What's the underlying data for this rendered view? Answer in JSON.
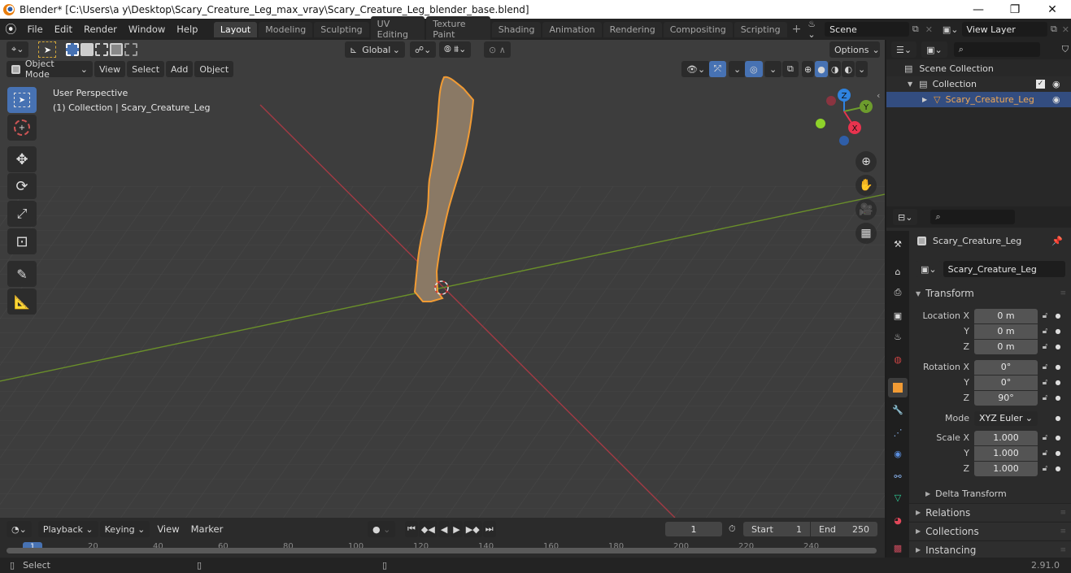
{
  "window": {
    "title": "Blender* [C:\\Users\\a y\\Desktop\\Scary_Creature_Leg_max_vray\\Scary_Creature_Leg_blender_base.blend]",
    "controls": {
      "minimize": "—",
      "maximize": "❐",
      "close": "✕"
    }
  },
  "menu": [
    "File",
    "Edit",
    "Render",
    "Window",
    "Help"
  ],
  "workspaces": [
    {
      "label": "Layout",
      "active": true
    },
    {
      "label": "Modeling"
    },
    {
      "label": "Sculpting"
    },
    {
      "label": "UV Editing"
    },
    {
      "label": "Texture Paint"
    },
    {
      "label": "Shading"
    },
    {
      "label": "Animation"
    },
    {
      "label": "Rendering"
    },
    {
      "label": "Compositing"
    },
    {
      "label": "Scripting"
    }
  ],
  "add_workspace": "+",
  "scene": {
    "value": "Scene"
  },
  "view_layer": {
    "value": "View Layer"
  },
  "viewport": {
    "mode": "Object Mode",
    "menus": [
      "View",
      "Select",
      "Add",
      "Object"
    ],
    "orientation": "Global",
    "options_label": "Options",
    "overlay_text": {
      "line1": "User Perspective",
      "line2": "(1) Collection | Scary_Creature_Leg"
    },
    "gizmo": {
      "x": "X",
      "y": "Y",
      "z": "Z",
      "colors": {
        "x": "#e8334e",
        "y": "#6d9c2d",
        "z": "#2f83e0"
      }
    },
    "tools": [
      "select-box",
      "cursor",
      "move",
      "rotate",
      "scale",
      "transform",
      "annotate",
      "measure"
    ],
    "nav": [
      "zoom",
      "pan",
      "camera",
      "ortho-grid"
    ]
  },
  "outliner": {
    "search_placeholder": "",
    "items": [
      {
        "label": "Scene Collection",
        "level": 0
      },
      {
        "label": "Collection",
        "level": 1,
        "checked": true
      },
      {
        "label": "Scary_Creature_Leg",
        "level": 2,
        "selected": true
      }
    ]
  },
  "properties": {
    "search_placeholder": "",
    "object_name": "Scary_Creature_Leg",
    "object_field": "Scary_Creature_Leg",
    "transform_header": "Transform",
    "location": {
      "label": "Location X",
      "x": "0 m",
      "y": "0 m",
      "z": "0 m"
    },
    "rotation": {
      "label": "Rotation X",
      "x": "0°",
      "y": "0°",
      "z": "90°"
    },
    "mode": {
      "label": "Mode",
      "value": "XYZ Euler"
    },
    "scale": {
      "label": "Scale X",
      "x": "1.000",
      "y": "1.000",
      "z": "1.000"
    },
    "axis_labels": {
      "y": "Y",
      "z": "Z"
    },
    "subpanels": [
      "Delta Transform"
    ],
    "panels": [
      "Relations",
      "Collections",
      "Instancing"
    ]
  },
  "timeline": {
    "menus": [
      "Playback",
      "Keying",
      "View",
      "Marker"
    ],
    "current_frame": "1",
    "start_label": "Start",
    "start": "1",
    "end_label": "End",
    "end": "250",
    "ticks": [
      "1",
      "20",
      "40",
      "60",
      "80",
      "100",
      "120",
      "140",
      "160",
      "180",
      "200",
      "220",
      "240"
    ]
  },
  "status": {
    "action": "Select",
    "version": "2.91.0"
  },
  "colors": {
    "accent": "#4772b3",
    "selection": "#f19b34",
    "x_axis": "#a33a44",
    "y_axis": "#6a8f2a"
  }
}
